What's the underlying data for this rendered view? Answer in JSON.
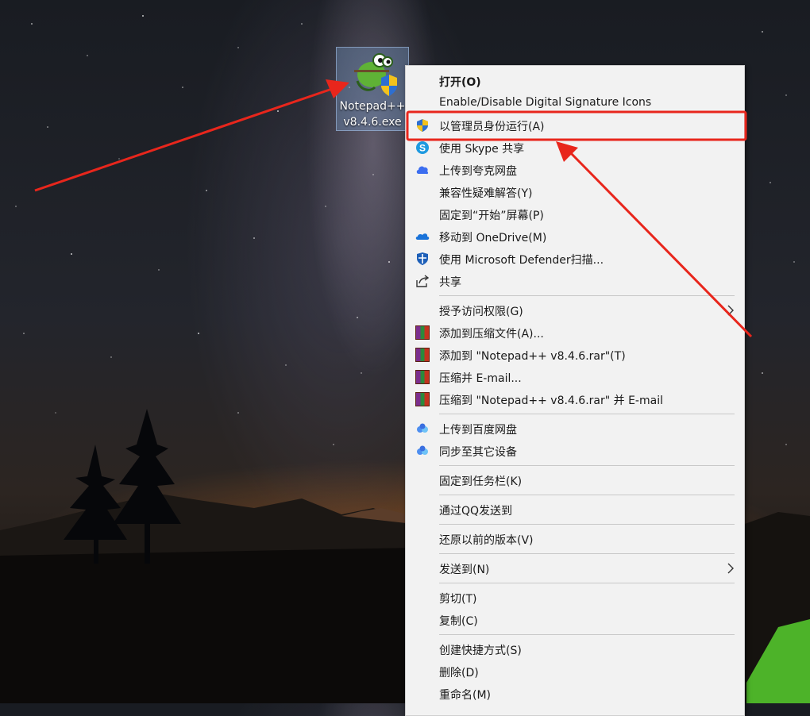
{
  "desktop": {
    "icon_label": "Notepad++\nv8.4.6.exe",
    "icon_name": "notepad-plus-plus-icon"
  },
  "menu": {
    "open": "打开(O)",
    "digital_signature": "Enable/Disable Digital Signature Icons",
    "run_as_admin": "以管理员身份运行(A)",
    "share_skype": "使用 Skype 共享",
    "upload_quark": "上传到夸克网盘",
    "troubleshoot": "兼容性疑难解答(Y)",
    "pin_start": "固定到“开始”屏幕(P)",
    "move_onedrive": "移动到 OneDrive(M)",
    "scan_defender": "使用 Microsoft Defender扫描...",
    "share": "共享",
    "grant_access": "授予访问权限(G)",
    "add_archive": "添加到压缩文件(A)...",
    "add_rar": "添加到 \"Notepad++ v8.4.6.rar\"(T)",
    "compress_email": "压缩并 E-mail...",
    "compress_rar_email": "压缩到 \"Notepad++ v8.4.6.rar\" 并 E-mail",
    "upload_baidu": "上传到百度网盘",
    "sync_devices": "同步至其它设备",
    "pin_taskbar": "固定到任务栏(K)",
    "send_qq": "通过QQ发送到",
    "restore_versions": "还原以前的版本(V)",
    "send_to": "发送到(N)",
    "cut": "剪切(T)",
    "copy": "复制(C)",
    "create_shortcut": "创建快捷方式(S)",
    "delete": "删除(D)",
    "rename": "重命名(M)"
  },
  "colors": {
    "highlight_box": "#e8261c",
    "arrow": "#e8261c",
    "menu_bg": "#f2f2f2"
  }
}
